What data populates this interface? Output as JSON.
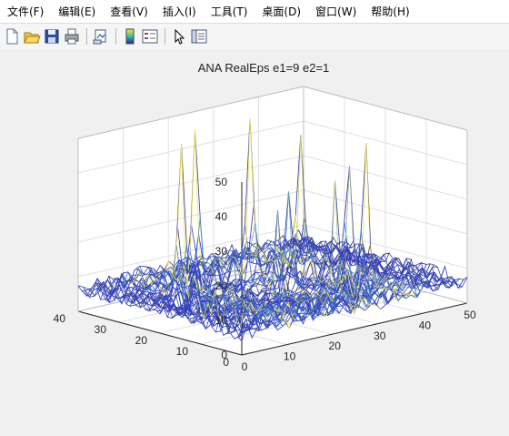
{
  "menu": [
    "文件(F)",
    "编辑(E)",
    "查看(V)",
    "插入(I)",
    "工具(T)",
    "桌面(D)",
    "窗口(W)",
    "帮助(H)"
  ],
  "toolbar": {
    "buttons": [
      "new-figure",
      "open-file",
      "save-figure",
      "print-figure",
      "link-plot",
      "insert-colorbar",
      "insert-legend",
      "edit-plot",
      "open-property-inspector"
    ]
  },
  "colors": {
    "background": "#f0f0f0",
    "axes_face": "#ffffff",
    "grid": "#e0e0e0",
    "surface_low": "#2d1b9e",
    "surface_mid": "#3c8ce0",
    "surface_high": "#f5e642"
  },
  "chart_data": {
    "type": "mesh",
    "title": "ANA  RealEps   e1=9   e2=1",
    "xlim": [
      0,
      50
    ],
    "ylim": [
      0,
      40
    ],
    "zlim": [
      0,
      50
    ],
    "xticks": [
      "0",
      "10",
      "20",
      "30",
      "40",
      "50"
    ],
    "yticks": [
      "0",
      "10",
      "20",
      "30",
      "40"
    ],
    "zticks": [
      "0",
      "10",
      "20",
      "30",
      "40",
      "50"
    ],
    "grid": true,
    "grid_size": [
      45,
      45
    ]
  }
}
